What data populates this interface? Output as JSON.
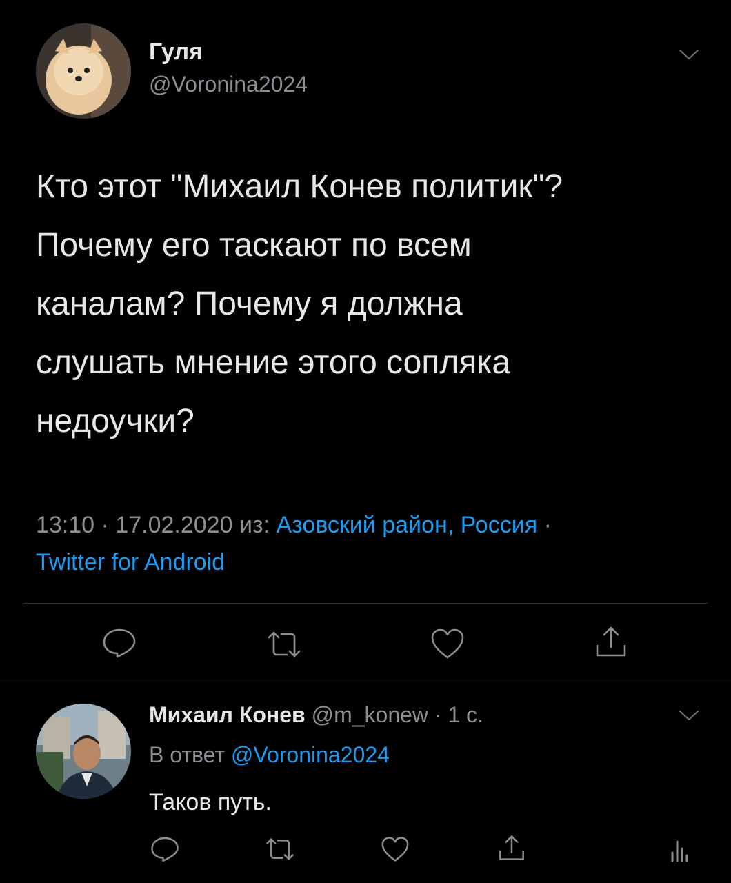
{
  "main_tweet": {
    "author_name": "Гуля",
    "author_handle": "@Voronina2024",
    "text_lines": [
      "Кто этот \"Михаил Конев политик\"?",
      "Почему его таскают по всем",
      "каналам? Почему я должна",
      "слушать мнение этого сопляка",
      "недоучки?"
    ],
    "time": "13:10",
    "separator": "·",
    "date": "17.02.2020",
    "from_label": "из:",
    "location": "Азовский район, Россия",
    "source": "Twitter for Android"
  },
  "reply_tweet": {
    "author_name": "Михаил Конев",
    "author_handle": "@m_konew",
    "separator": "·",
    "age": "1 с.",
    "reply_to_label": "В ответ",
    "reply_to_handle": "@Voronina2024",
    "text": "Таков путь."
  },
  "icons": {
    "reply": "comment-icon",
    "retweet": "retweet-icon",
    "like": "heart-icon",
    "share": "share-icon",
    "analytics": "analytics-icon",
    "menu": "chevron-down-icon"
  },
  "colors": {
    "background": "#000000",
    "link": "#1d9bf0",
    "muted": "#8b8f94",
    "text": "#e7e7e7"
  }
}
